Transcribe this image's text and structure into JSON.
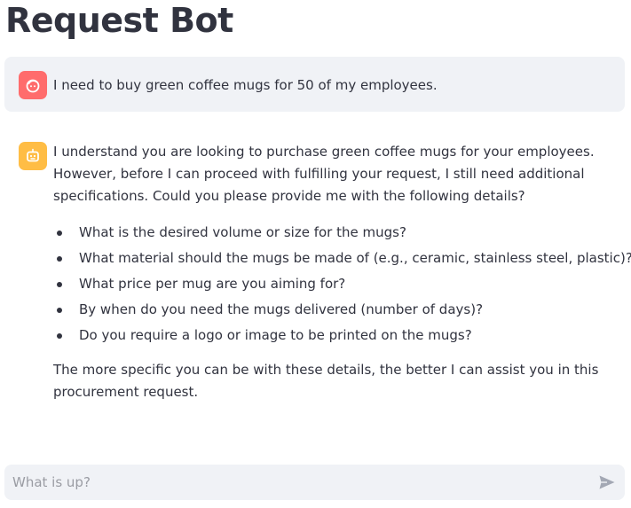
{
  "app": {
    "title": "Request Bot"
  },
  "colors": {
    "user_avatar": "#ff6c6c",
    "bot_avatar": "#ffbd45",
    "bubble_bg": "#f0f2f6",
    "text": "#31333f"
  },
  "messages": {
    "user": {
      "avatar_icon": "user-face-icon",
      "text": "I need to buy green coffee mugs for 50 of my employees."
    },
    "assistant": {
      "avatar_icon": "robot-icon",
      "intro": "I understand you are looking to purchase green coffee mugs for your employees. However, before I can proceed with fulfilling your request, I still need additional specifications. Could you please provide me with the following details?",
      "questions": [
        "What is the desired volume or size for the mugs?",
        "What material should the mugs be made of (e.g., ceramic, stainless steel, plastic)?",
        "What price per mug are you aiming for?",
        "By when do you need the mugs delivered (number of days)?",
        "Do you require a logo or image to be printed on the mugs?"
      ],
      "outro": "The more specific you can be with these details, the better I can assist you in this procurement request."
    }
  },
  "chat_input": {
    "placeholder": "What is up?",
    "value": "",
    "send_icon": "send-icon"
  }
}
